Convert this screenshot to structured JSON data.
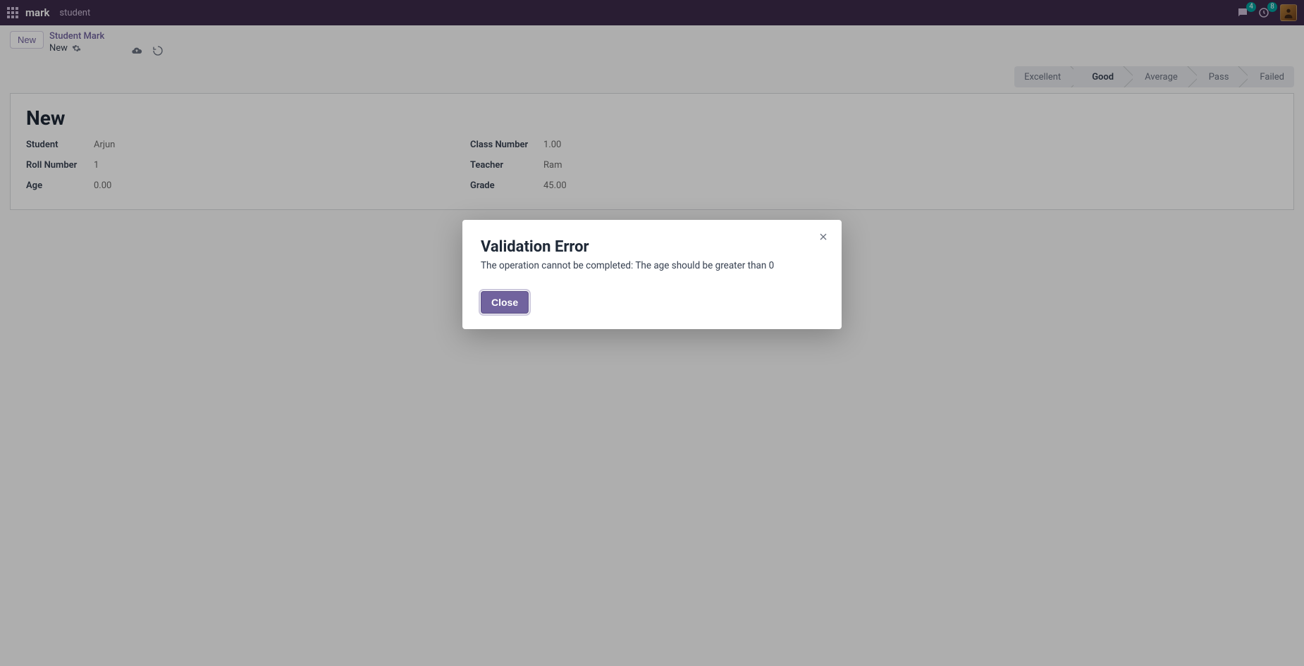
{
  "topbar": {
    "app_name": "mark",
    "nav_item": "student",
    "messages_badge": "4",
    "activities_badge": "8"
  },
  "controlbar": {
    "new_button": "New",
    "breadcrumb_title": "Student Mark",
    "breadcrumb_sub": "New"
  },
  "statusbar": {
    "steps": [
      "Excellent",
      "Good",
      "Average",
      "Pass",
      "Failed"
    ],
    "active_index": 1
  },
  "form": {
    "title": "New",
    "left": [
      {
        "label": "Student",
        "value": "Arjun"
      },
      {
        "label": "Roll Number",
        "value": "1"
      },
      {
        "label": "Age",
        "value": "0.00"
      }
    ],
    "right": [
      {
        "label": "Class Number",
        "value": "1.00"
      },
      {
        "label": "Teacher",
        "value": "Ram"
      },
      {
        "label": "Grade",
        "value": "45.00"
      }
    ]
  },
  "modal": {
    "title": "Validation Error",
    "message": "The operation cannot be completed: The age should be greater than 0",
    "close_label": "Close"
  }
}
